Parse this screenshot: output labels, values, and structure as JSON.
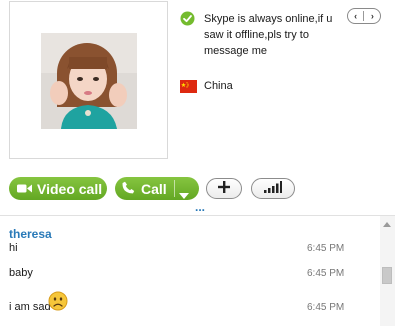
{
  "profile": {
    "photo_icon": "profile-photo",
    "mood_message": "Skype is always online,if u saw it offline,pls try to message me",
    "status_icon": "online-check-icon",
    "location": "China",
    "flag_icon": "china-flag-icon"
  },
  "pager": {
    "prev": "‹",
    "next": "›"
  },
  "toolbar": {
    "video_call_label": "Video call",
    "call_label": "Call",
    "add_icon": "plus-icon",
    "signal_icon": "signal-bars-icon",
    "more_indicator": "..."
  },
  "chat": {
    "sender": "theresa",
    "messages": [
      {
        "text": "hi",
        "time": "6:45 PM"
      },
      {
        "text": "baby",
        "time": "6:45 PM"
      },
      {
        "text": "i am sad",
        "time": "6:45 PM",
        "emoticon": "sad-emoticon"
      }
    ]
  },
  "colors": {
    "accent_green": "#6db52c",
    "link_blue": "#2a7ab8",
    "flag_red": "#de2910"
  }
}
